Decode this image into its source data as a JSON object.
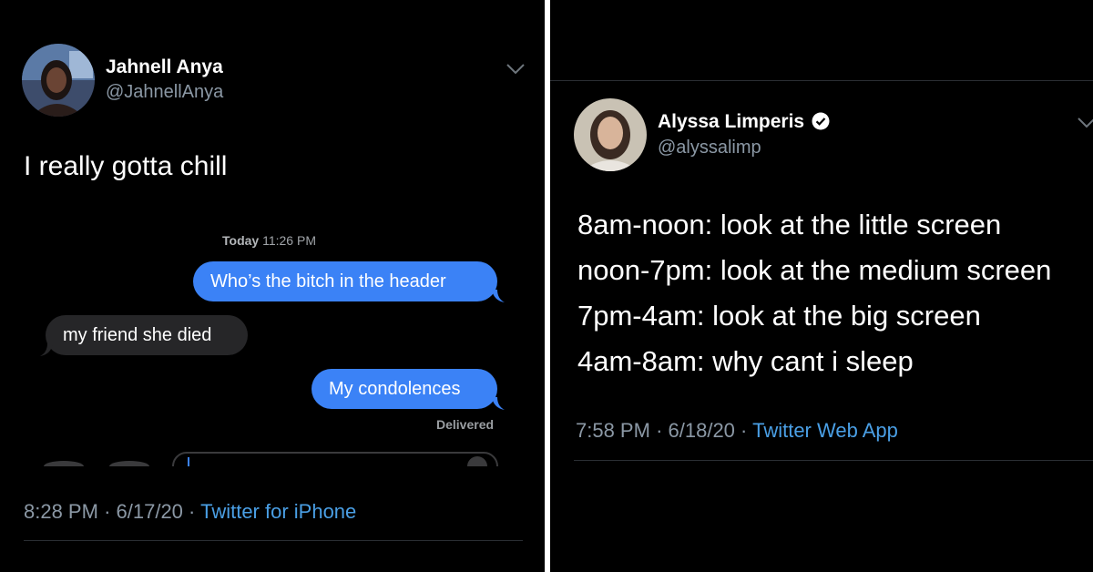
{
  "left_tweet": {
    "display_name": "Jahnell Anya",
    "handle": "@JahnellAnya",
    "text": "I really gotta chill",
    "imessage": {
      "timestamp_day": "Today",
      "timestamp_time": "11:26 PM",
      "messages": [
        {
          "from": "me",
          "text": "Who’s the bitch in the header"
        },
        {
          "from": "them",
          "text": "my friend she died"
        },
        {
          "from": "me",
          "text": "My condolences"
        }
      ],
      "status": "Delivered"
    },
    "time": "8:28 PM",
    "date": "6/17/20",
    "source": "Twitter for iPhone",
    "separator": "·"
  },
  "right_tweet": {
    "display_name": "Alyssa Limperis",
    "verified": true,
    "handle": "@alyssalimp",
    "lines": [
      "8am-noon: look at the little screen",
      "noon-7pm: look at the medium screen",
      "7pm-4am: look at the big screen",
      "4am-8am: why cant i sleep"
    ],
    "time": "7:58 PM",
    "date": "6/18/20",
    "source": "Twitter Web App",
    "separator": "·"
  },
  "colors": {
    "background": "#000000",
    "secondary_text": "#8b98a5",
    "link": "#4a9fe5",
    "imessage_blue": "#3b82f6",
    "imessage_gray": "#262628"
  },
  "icons": {
    "more": "chevron-down-icon",
    "verified": "verified-badge-icon"
  }
}
